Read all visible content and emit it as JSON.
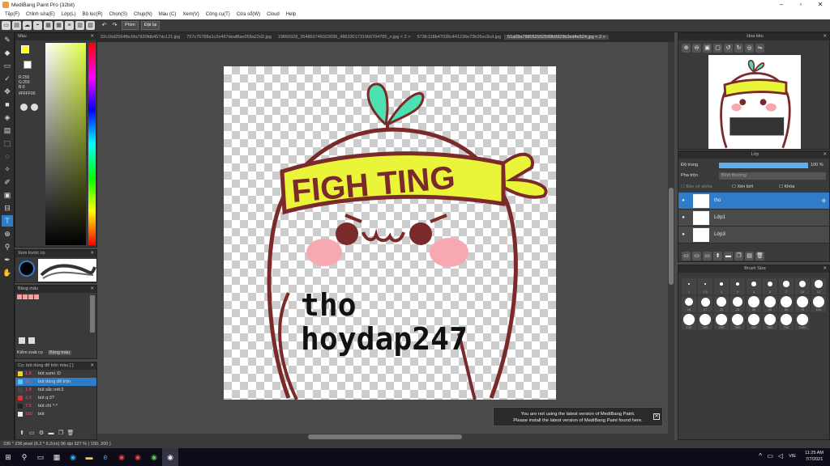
{
  "app": {
    "title": "MediBang Paint Pro (32bit)"
  },
  "menu": [
    "Tệp(F)",
    "Chỉnh sửa(E)",
    "Lớp(L)",
    "Bộ lọc(R)",
    "Chọn(S)",
    "Chụp(N)",
    "Màu (C)",
    "Xem(V)",
    "Công cụ(T)",
    "Cửa sổ(W)",
    "Cloud",
    "Help"
  ],
  "toolbar": {
    "snap_label": "Phím",
    "snap_off": "Đặt lại"
  },
  "tabs": [
    "22c16d2594fbc6fa7930fdb457dc121.jpg",
    "757c76788a1c2e467deaf8ae058a22d2.jpg",
    "19860928_354860746022699_4863301731966704785_n.jpg < 2 >",
    "573fc118b47036c441236e73b26ec9cd.jpg",
    "51a09a788052932599b9929b3ed4e524.jpg < 2 >"
  ],
  "color_panel": {
    "title": "Màu",
    "r": "R:255",
    "g": "G:255",
    "b": "B:0",
    "hex": "#FFFF00"
  },
  "brush_preview": {
    "title": "Xem trước cọ"
  },
  "palette": {
    "title": "Bảng màu",
    "tab1": "Kiểm soát cọ",
    "tab2": "Bảng màu"
  },
  "brushes": {
    "title": "Cọ: bút dùng để trộn màu [ ]",
    "items": [
      {
        "size": "1.8",
        "name": "bút sumi :D",
        "color": "#f5d020"
      },
      {
        "size": "20",
        "name": "bút dùng để trộn",
        "color": "#5bc4f0"
      },
      {
        "size": "1.8",
        "name": "bút sắc nét:3",
        "color": "#444444"
      },
      {
        "size": "3.3",
        "name": "bút q:3?",
        "color": "#e03030"
      },
      {
        "size": "7.5",
        "name": "bút chì *-*",
        "color": "#222222"
      },
      {
        "size": "150",
        "name": "bút",
        "color": "#f0f0f0"
      }
    ]
  },
  "canvas": {
    "headband_text": "FIGH TING",
    "overlay_line1": "tho",
    "overlay_line2": "hoydap247"
  },
  "notice": {
    "line1": "You are not using the latest version of MediBang Paint.",
    "line2": "Please install the latest version of MediBang Paint found here."
  },
  "navigator": {
    "title": "Hoa tiêu"
  },
  "layers_panel": {
    "title": "Lớp",
    "opacity_label": "Độ trong",
    "opacity_value": "100 %",
    "blend_label": "Pha trộn",
    "blend_value": "Bình thường",
    "protect_alpha": "Bảo vệ alpha",
    "clipping": "Xén bớt",
    "lock": "Khóa",
    "layers": [
      {
        "name": "tho"
      },
      {
        "name": "Lớp1"
      },
      {
        "name": "Lớp3"
      }
    ]
  },
  "brush_size": {
    "title": "Brush Size",
    "sizes": [
      "1",
      "1.5",
      "2",
      "3",
      "4",
      "5",
      "7",
      "10",
      "12",
      "15",
      "17",
      "20",
      "25",
      "30",
      "40",
      "50",
      "70",
      "100",
      "150",
      "200",
      "250",
      "300",
      "400",
      "500",
      "700",
      "1000"
    ]
  },
  "status": {
    "text": "236 * 236 pixel (6.2 * 6.2cm) 96 dpi 327 % ( 150, 200 )"
  },
  "taskbar": {
    "time": "11:25 AM",
    "date": "7/7/2021",
    "lang": "VIE"
  }
}
